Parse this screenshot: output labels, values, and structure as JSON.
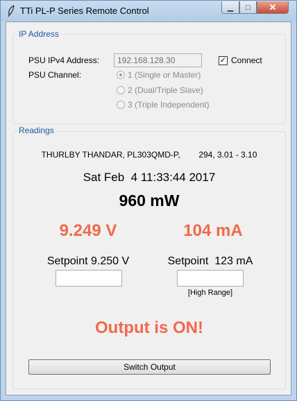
{
  "window": {
    "title": "TTi PL-P Series Remote Control",
    "icon": "feather-icon",
    "minimize_glyph": "▁",
    "maximize_glyph": "□",
    "close_glyph": "✕"
  },
  "ip_group": {
    "legend": "IP Address",
    "address_label": "PSU IPv4 Address:",
    "address_value": "192.168.128.30",
    "connect_label": "Connect",
    "connect_checked": true,
    "connect_check_glyph": "✓",
    "channel_label": "PSU Channel:",
    "channels": [
      {
        "label": "1 (Single or Master)",
        "selected": true
      },
      {
        "label": "2 (Dual/Triple Slave)",
        "selected": false
      },
      {
        "label": "3 (Triple Independent)",
        "selected": false
      }
    ]
  },
  "readings": {
    "legend": "Readings",
    "idn": "THURLBY THANDAR, PL303QMD-P,        294, 3.01 - 3.10",
    "clock": "Sat Feb  4 11:33:44 2017",
    "power": "960 mW",
    "voltage": "9.249 V",
    "current": "104 mA",
    "voltage_setpoint_label": "Setpoint 9.250 V",
    "current_setpoint_label": "Setpoint  123 mA",
    "range_label": "[High Range]",
    "output_status": "Output is ON!",
    "switch_button": "Switch Output"
  },
  "colors": {
    "measurement": "#f06a4a",
    "legend": "#1f55a8"
  }
}
